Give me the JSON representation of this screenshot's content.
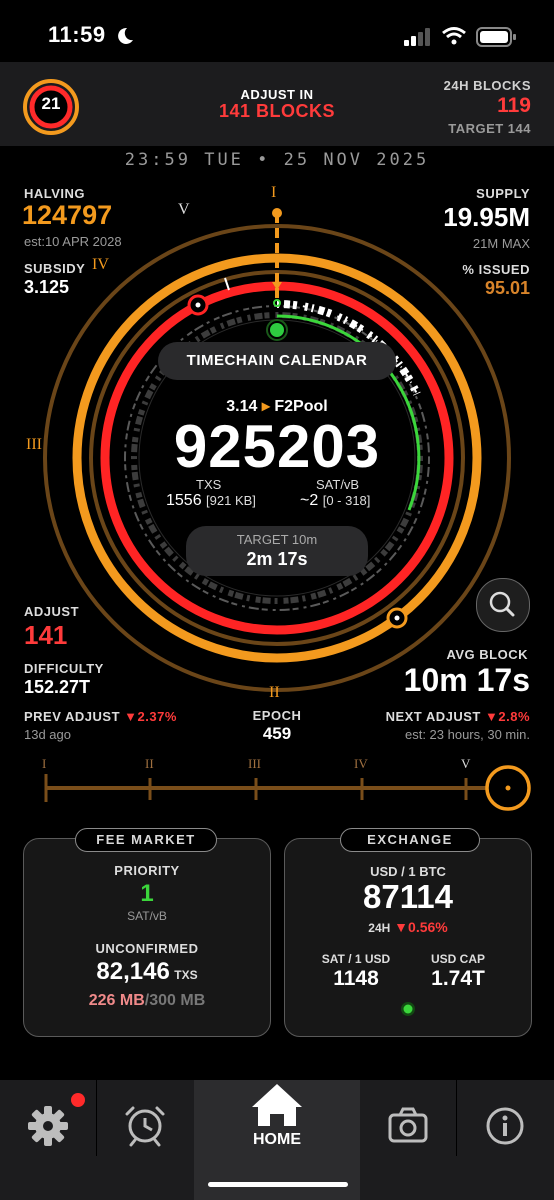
{
  "status_bar": {
    "time": "11:59"
  },
  "header": {
    "badge": "21",
    "adjust_in_label": "ADJUST IN",
    "adjust_in_value": "141 BLOCKS",
    "blocks24_label": "24H BLOCKS",
    "blocks24_value": "119",
    "target_label": "TARGET 144"
  },
  "datetime": "23:59 TUE • 25 NOV 2025",
  "halving": {
    "label": "HALVING",
    "value": "124797",
    "est": "est:10 APR 2028"
  },
  "subsidy": {
    "label": "SUBSIDY",
    "value": "3.125"
  },
  "supply": {
    "label": "SUPPLY",
    "value": "19.95M",
    "max": "21M MAX"
  },
  "issued": {
    "label": "% ISSUED",
    "value": "95.01"
  },
  "dial": {
    "numerals": {
      "i": "I",
      "ii": "II",
      "iii": "III",
      "iv": "IV",
      "v": "V"
    },
    "calendar_label": "TIMECHAIN CALENDAR",
    "block_time": "3.14",
    "pool": "F2Pool",
    "block_height": "925203",
    "txs_label": "TXS",
    "txs_value": "1556",
    "txs_size": "[921 KB]",
    "satvb_label": "SAT/vB",
    "satvb_value": "~2",
    "satvb_range": "[0 - 318]",
    "target_label": "TARGET 10m",
    "target_value": "2m 17s"
  },
  "adjust": {
    "label": "ADJUST",
    "value": "141"
  },
  "difficulty": {
    "label": "DIFFICULTY",
    "value": "152.27T"
  },
  "avg_block": {
    "label": "AVG BLOCK",
    "value": "10m 17s"
  },
  "prev_adjust": {
    "label": "PREV ADJUST",
    "value": "▼2.37%",
    "ago": "13d ago"
  },
  "epoch": {
    "label": "EPOCH",
    "value": "459"
  },
  "next_adjust": {
    "label": "NEXT ADJUST",
    "value": "▼2.8%",
    "est": "est: 23 hours, 30 min."
  },
  "timeline": {
    "labels": [
      "I",
      "II",
      "III",
      "IV",
      "V"
    ],
    "progress": 0.95
  },
  "fee_market": {
    "title": "FEE MARKET",
    "priority_label": "PRIORITY",
    "priority_value": "1",
    "priority_unit": "SAT/vB",
    "unconfirmed_label": "UNCONFIRMED",
    "unconfirmed_value": "82,146",
    "unconfirmed_unit": "TXS",
    "mempool_used": "226 MB",
    "mempool_sep": "/",
    "mempool_max": "300 MB"
  },
  "exchange": {
    "title": "EXCHANGE",
    "pair_label": "USD / 1 BTC",
    "price": "87114",
    "change_label": "24H",
    "change_value": "▼0.56%",
    "sat_label": "SAT / 1 USD",
    "sat_value": "1148",
    "cap_label": "USD CAP",
    "cap_value": "1.74T"
  },
  "tabbar": {
    "home_label": "HOME"
  },
  "colors": {
    "orange": "#f39a1e",
    "red": "#ff2a2a",
    "brown": "#8a5a22",
    "green": "#3bd63b"
  }
}
